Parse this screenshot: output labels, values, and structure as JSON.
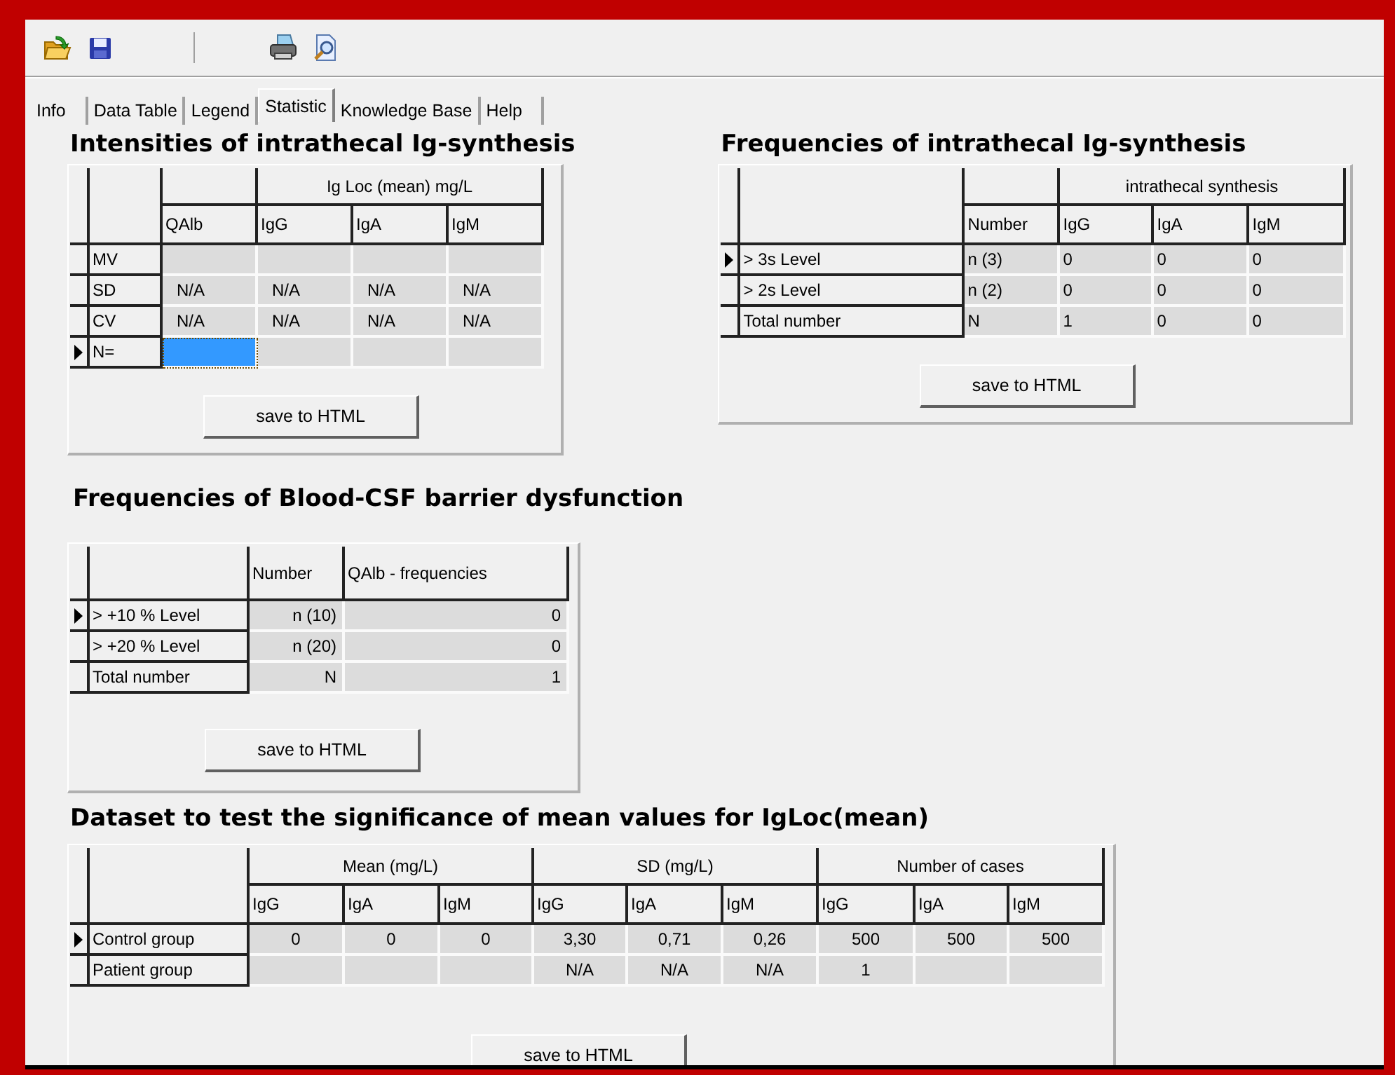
{
  "tabs": [
    {
      "label": "Info",
      "selected": false
    },
    {
      "label": "Data Table",
      "selected": false
    },
    {
      "label": "Legend",
      "selected": false
    },
    {
      "label": "Statistic",
      "selected": true
    },
    {
      "label": "Knowledge Base",
      "selected": false
    },
    {
      "label": "Help",
      "selected": false
    }
  ],
  "sections": [
    {
      "title": "Intensities of intrathecal Ig-synthesis",
      "button": "save to HTML",
      "headers": [
        {
          "kind": "single",
          "label": "QAlb"
        },
        {
          "kind": "group",
          "label": "Ig Loc (mean) mg/L",
          "columns": [
            "IgG",
            "IgA",
            "IgM"
          ]
        }
      ],
      "rows": [
        {
          "label": "MV",
          "current": false,
          "cells": [
            {
              "selected": false
            },
            {
              "selected": false
            },
            {
              "selected": false
            },
            {
              "selected": false
            }
          ]
        },
        {
          "label": "SD",
          "current": false,
          "cells": [
            {
              "text": "N/A",
              "selected": false
            },
            {
              "text": "N/A",
              "selected": false
            },
            {
              "text": "N/A",
              "selected": false
            },
            {
              "text": "N/A",
              "selected": false
            }
          ]
        },
        {
          "label": "CV",
          "current": false,
          "cells": [
            {
              "text": "N/A",
              "selected": false
            },
            {
              "text": "N/A",
              "selected": false
            },
            {
              "text": "N/A",
              "selected": false
            },
            {
              "text": "N/A",
              "selected": false
            }
          ]
        },
        {
          "label": "N=",
          "current": true,
          "cells": [
            {
              "selected": true
            },
            {
              "selected": false
            },
            {
              "selected": false
            },
            {
              "selected": false
            }
          ]
        }
      ]
    },
    {
      "title": "Frequencies of intrathecal Ig-synthesis",
      "button": "save to HTML",
      "headers": [
        {
          "kind": "single",
          "label": "Number"
        },
        {
          "kind": "group",
          "label": "intrathecal synthesis",
          "columns": [
            "IgG",
            "IgA",
            "IgM"
          ]
        }
      ],
      "rows": [
        {
          "label": "> 3s Level",
          "current": true,
          "cells": [
            "n (3)",
            "0",
            "0",
            "0"
          ]
        },
        {
          "label": "> 2s Level",
          "current": false,
          "cells": [
            "n (2)",
            "0",
            "0",
            "0"
          ]
        },
        {
          "label": "Total number",
          "current": false,
          "cells": [
            "N",
            "1",
            "0",
            "0"
          ]
        }
      ]
    },
    {
      "title": "Frequencies of Blood-CSF barrier dysfunction",
      "button": "save to HTML",
      "headers": [
        {
          "kind": "single",
          "label": "Number"
        },
        {
          "kind": "single",
          "label": "QAlb - frequencies"
        }
      ],
      "rows": [
        {
          "label": "> +10 % Level",
          "current": true,
          "cells": [
            "n (10)",
            "0"
          ]
        },
        {
          "label": "> +20 % Level",
          "current": false,
          "cells": [
            "n (20)",
            "0"
          ]
        },
        {
          "label": "Total number",
          "current": false,
          "cells": [
            "N",
            "1"
          ]
        }
      ]
    },
    {
      "title": "Dataset to test the significance of mean values for IgLoc(mean)",
      "button": "save to HTML",
      "headers": [
        {
          "kind": "group",
          "label": "Mean (mg/L)",
          "columns": [
            "IgG",
            "IgA",
            "IgM"
          ]
        },
        {
          "kind": "group",
          "label": "SD (mg/L)",
          "columns": [
            "IgG",
            "IgA",
            "IgM"
          ]
        },
        {
          "kind": "group",
          "label": "Number of cases",
          "columns": [
            "IgG",
            "IgA",
            "IgM"
          ]
        }
      ],
      "rows": [
        {
          "label": "Control group",
          "current": true,
          "cells": [
            "0",
            "0",
            "0",
            "3,30",
            "0,71",
            "0,26",
            "500",
            "500",
            "500"
          ]
        },
        {
          "label": "Patient group",
          "current": false,
          "cells": [
            null,
            null,
            null,
            "N/A",
            "N/A",
            "N/A",
            "1",
            null,
            null
          ]
        }
      ]
    }
  ]
}
